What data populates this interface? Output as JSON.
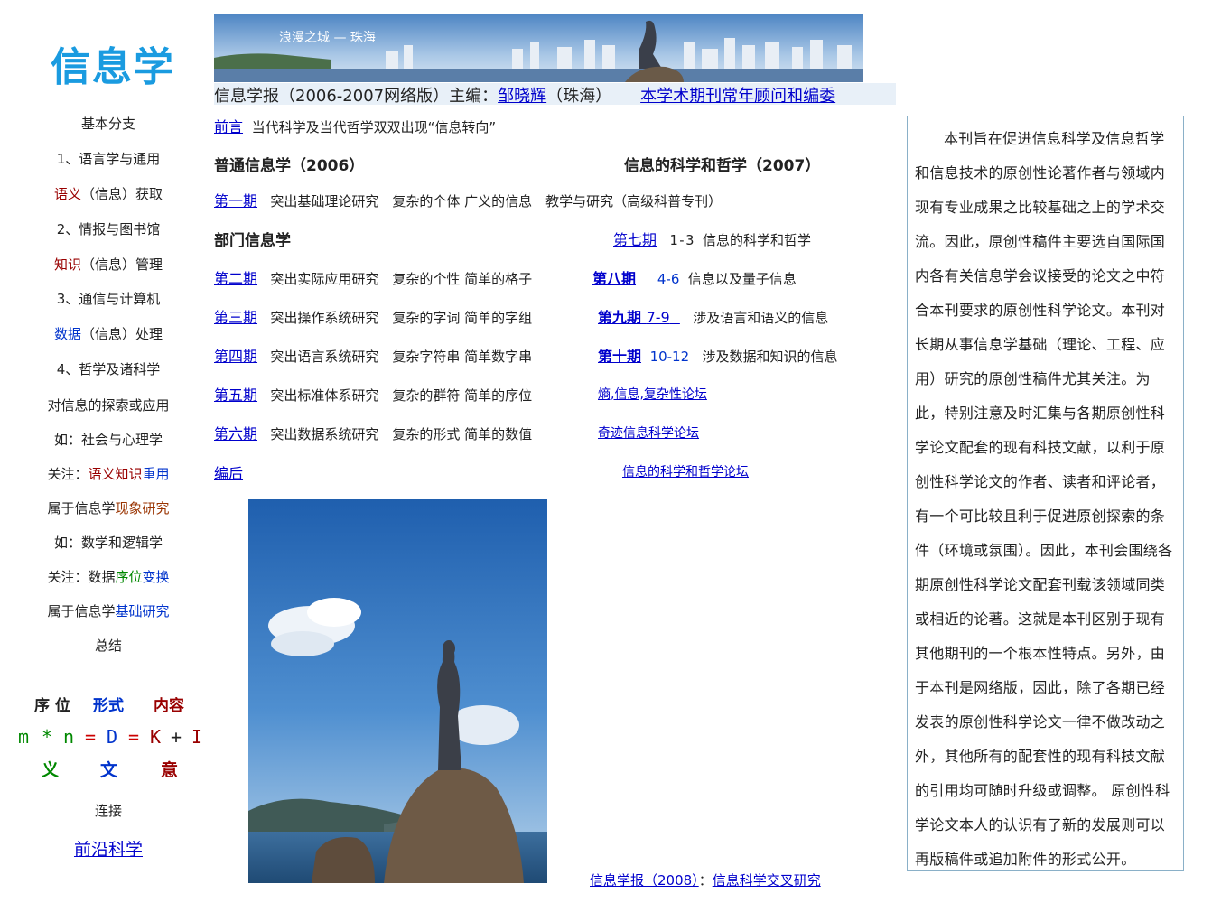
{
  "left": {
    "title": "信息学",
    "branches_label": "基本分支",
    "b1": "1、语言学与通用",
    "b1_sub_a": "语义",
    "b1_sub_b": "（信息）获取",
    "b2": "2、情报与图书馆",
    "b2_sub_a": "知识",
    "b2_sub_b": "（信息）管理",
    "b3": "3、通信与计算机",
    "b3_sub_a": "数据",
    "b3_sub_b": "（信息）处理",
    "b4": "4、哲学及诸科学",
    "b4_sub": "对信息的探索或应用",
    "ex1": "如：社会与心理学",
    "focus1_a": "关注：",
    "focus1_b": "语义知识",
    "focus1_c": "重用",
    "belong1_a": "属于信息学",
    "belong1_b": "现象研究",
    "ex2": "如：数学和逻辑学",
    "focus2_a": "关注：数据",
    "focus2_b": "序位",
    "focus2_c": "变换",
    "belong2_a": "属于信息学",
    "belong2_b": "基础研究",
    "summary": "总结",
    "formula": {
      "h1": "序 位",
      "h2": "形式",
      "h3": "内容",
      "m": "m",
      "star": "*",
      "n": "n",
      "eq1": "=",
      "d": "D",
      "eq2": "=",
      "k": "K",
      "plus": "+",
      "i": "I",
      "f1": "义",
      "f2": "文",
      "f3": "意"
    },
    "link_label": "连接",
    "frontier_link": "前沿科学"
  },
  "banner": {
    "caption": "浪漫之城 — 珠海"
  },
  "journal": {
    "title_a": "信息学报（2006-2007",
    "title_b": "网络版）主编：",
    "editor": "邹晓辉",
    "location": "（珠海）",
    "advisors_link": "本学术期刊常年顾问和编委"
  },
  "preface": {
    "link": "前言",
    "text": "当代科学及当代哲学双双出现“信息转向”"
  },
  "col_left": {
    "heading_general": "普通信息学（2006）",
    "heading_dept": "部门信息学",
    "issues": [
      {
        "link": "第一期",
        "text": "突出基础理论研究　复杂的个体 广义的信息　教学与研究（高级科普专刊）"
      },
      {
        "link": "第二期",
        "text": "突出实际应用研究　复杂的个性 简单的格子"
      },
      {
        "link": "第三期",
        "text": "突出操作系统研究　复杂的字词 简单的字组"
      },
      {
        "link": "第四期",
        "text": "突出语言系统研究　复杂字符串 简单数字串"
      },
      {
        "link": "第五期",
        "text": "突出标准体系研究　复杂的群符 简单的序位"
      },
      {
        "link": "第六期",
        "text": "突出数据系统研究　复杂的形式 简单的数值"
      }
    ],
    "afterword": "编后"
  },
  "col_right": {
    "heading": "信息的科学和哲学（2007）",
    "issue7_link": "第七期",
    "issue7_range": "1-3",
    "issue7_text": "信息的科学和哲学",
    "issue8_link": "第八期",
    "issue8_range": "4-6",
    "issue8_text": "信息以及量子信息",
    "issue9_link": "第九期",
    "issue9_range": "7-9",
    "issue9_text": "涉及语言和语义的信息",
    "issue10_link": "第十期",
    "issue10_range": "10-12",
    "issue10_text": "涉及数据和知识的信息",
    "forum1": "熵,信息,复杂性论坛",
    "forum2": "奇迹信息科学论坛",
    "forum3": "信息的科学和哲学论坛"
  },
  "bottom": {
    "link1": "信息学报（2008）",
    "sep": "：",
    "link2": "信息科学交叉研究"
  },
  "intro": {
    "text": "本刊旨在促进信息科学及信息哲学和信息技术的原创性论著作者与领域内现有专业成果之比较基础之上的学术交流。因此，原创性稿件主要选自国际国内各有关信息学会议接受的论文之中符合本刊要求的原创性科学论文。本刊对长期从事信息学基础（理论、工程、应用）研究的原创性稿件尤其关注。为此，特别注意及时汇集与各期原创性科学论文配套的现有科技文献，以利于原创性科学论文的作者、读者和评论者，有一个可比较且利于促进原创探索的条件（环境或氛围）。因此，本刊会围绕各期原创性科学论文配套刊载该领域同类或相近的论著。这就是本刊区别于现有其他期刊的一个根本性特点。另外，由于本刊是网络版，因此，除了各期已经发表的原创性科学论文一律不做改动之外，其他所有的配套性的现有科技文献的引用均可随时升级或调整。 原创性科学论文本人的认识有了新的发展则可以再版稿件或追加附件的形式公开。"
  },
  "colors": {
    "title_blue": "#1a9be0",
    "link_blue": "#0000cc",
    "accent_red": "#990000",
    "accent_green": "#008800"
  }
}
